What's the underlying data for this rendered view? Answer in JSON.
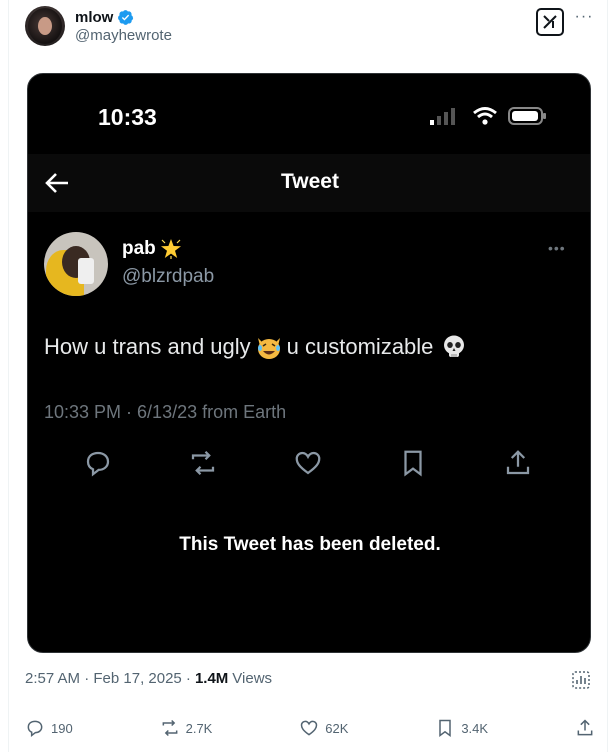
{
  "author": {
    "display_name": "mlow",
    "handle": "@mayhewrote"
  },
  "header": {
    "more_label": "···"
  },
  "embedded_tweet": {
    "status_time": "10:33",
    "top_bar_title": "Tweet",
    "name": "pab",
    "handle": "@blzrdpab",
    "text_part1": "How u trans and ugly",
    "text_part2": "u customizable",
    "meta": "10:33 PM · 6/13/23 from Earth",
    "deleted_notice": "This Tweet has been deleted."
  },
  "post_meta": {
    "time_date": "2:57 AM · Feb 17, 2025 ·",
    "views_count": "1.4M",
    "views_label": "Views"
  },
  "actions": {
    "replies": "190",
    "reposts": "2.7K",
    "likes": "62K",
    "bookmarks": "3.4K"
  },
  "colors": {
    "verified_blue": "#1d9bf0",
    "text_secondary": "#536471"
  },
  "icons": [
    "verified-badge-icon",
    "grok-icon",
    "more-icon",
    "back-arrow-icon",
    "star-emoji-icon",
    "laughing-cat-emoji-icon",
    "skull-emoji-icon",
    "reply-icon",
    "repost-icon",
    "like-icon",
    "bookmark-icon",
    "share-icon",
    "analytics-icon",
    "wifi-icon",
    "signal-icon",
    "battery-icon"
  ]
}
